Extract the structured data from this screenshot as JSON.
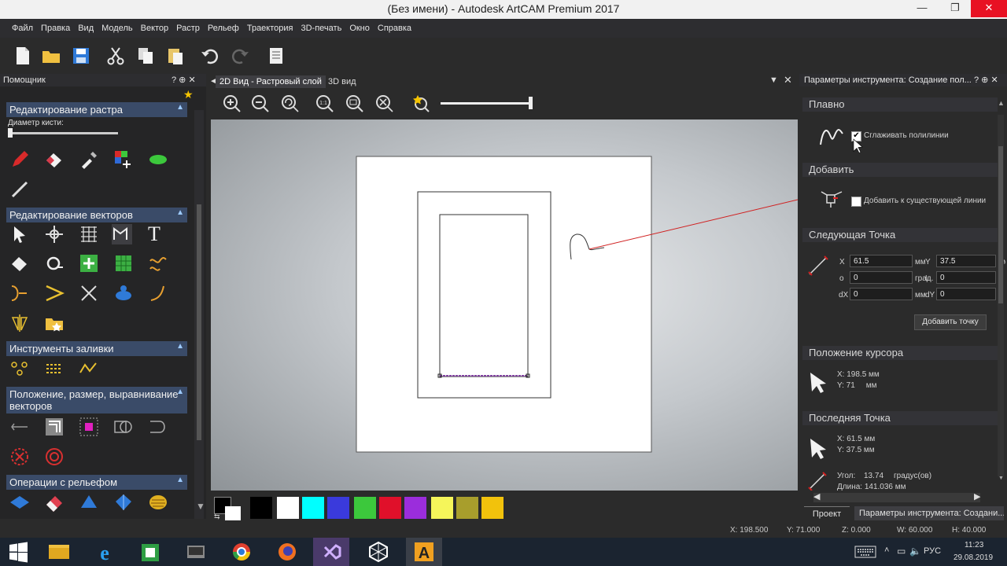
{
  "window": {
    "title": "(Без имени) - Autodesk ArtCAM Premium 2017"
  },
  "menu": [
    "Файл",
    "Правка",
    "Вид",
    "Модель",
    "Вектор",
    "Растр",
    "Рельеф",
    "Траектория",
    "3D-печать",
    "Окно",
    "Справка"
  ],
  "left_panel": {
    "title": "Помощник",
    "sections": {
      "raster": "Редактирование растра",
      "brush_label": "Диаметр кисти:",
      "vector": "Редактирование векторов",
      "fill": "Инструменты заливки",
      "position": "Положение, размер, выравнивание векторов",
      "relief": "Операции с рельефом"
    }
  },
  "doc_tabs": [
    "2D Вид - Растровый слой",
    "3D вид"
  ],
  "right_panel": {
    "title": "Параметры инструмента: Создание пол...",
    "smooth": {
      "header": "Плавно",
      "checkbox_label": "Сглаживать полилинии",
      "checked": true
    },
    "add": {
      "header": "Добавить",
      "checkbox_label": "Добавить к существующей линии",
      "checked": false
    },
    "next_point": {
      "header": "Следующая Точка",
      "x_label": "X",
      "x_value": "61.5",
      "x_unit": "мм",
      "y_label": "Y",
      "y_value": "37.5",
      "y_unit": "мм",
      "o_label": "o",
      "o_value": "0",
      "o_unit": "град.",
      "l_label": "L",
      "l_value": "0",
      "dx_label": "dX",
      "dx_value": "0",
      "dx_unit": "мм",
      "dy_label": "dY",
      "dy_value": "0",
      "add_button": "Добавить точку"
    },
    "cursor_pos": {
      "header": "Положение курсора",
      "x": "X: 198.5 мм",
      "y": "Y: 71     мм"
    },
    "last_point": {
      "header": "Последняя Точка",
      "x": "X: 61.5 мм",
      "y": "Y: 37.5 мм",
      "angle_label": "Угол:",
      "angle_value": "13.74",
      "angle_unit": "градус(ов)",
      "length": "Длина: 141.036 мм"
    },
    "bottom_tabs": [
      "Проект",
      "Параметры инструмента: Создани..."
    ]
  },
  "palette": {
    "colors": [
      "#000000",
      "#ffffff",
      "#00ffff",
      "#3a3adc",
      "#3cc83c",
      "#e0102a",
      "#9b2ddc",
      "#f5f55a",
      "#a89e2c",
      "#f2c20c"
    ]
  },
  "status": {
    "x": "X: 198.500",
    "y": "Y: 71.000",
    "z": "Z: 0.000",
    "w": "W: 60.000",
    "h": "H: 40.000"
  },
  "taskbar": {
    "lang": "РУС",
    "time": "11:23",
    "date": "29.08.2019"
  }
}
